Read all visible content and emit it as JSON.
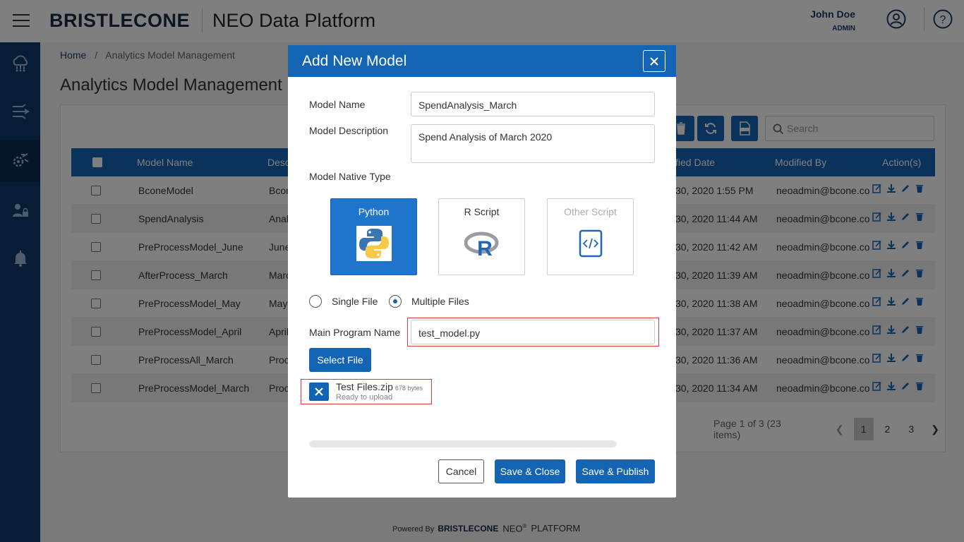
{
  "header": {
    "brand": "BRISTLECONE",
    "app_title": "NEO Data Platform",
    "user_name": "John Doe",
    "user_role": "ADMIN"
  },
  "sidebar": {
    "items": [
      {
        "icon": "cloud-network-icon"
      },
      {
        "icon": "data-flow-icon"
      },
      {
        "icon": "analytics-model-icon",
        "active": true
      },
      {
        "icon": "user-admin-icon"
      },
      {
        "icon": "bell-icon"
      }
    ]
  },
  "breadcrumb": {
    "home": "Home",
    "separator": "/",
    "current": "Analytics Model Management"
  },
  "page_title": "Analytics Model Management",
  "toolbar": {
    "search_placeholder": "Search"
  },
  "table": {
    "headers": {
      "model_name": "Model Name",
      "description": "Desc",
      "modified_date": "fied Date",
      "modified_by": "Modified By",
      "actions": "Action(s)"
    },
    "rows": [
      {
        "name": "BconeModel",
        "desc": "Bcon",
        "date": "30, 2020 1:55 PM",
        "by": "neoadmin@bcone.cor"
      },
      {
        "name": "SpendAnalysis",
        "desc": "Anal",
        "date": "30, 2020 11:44 AM",
        "by": "neoadmin@bcone.cor"
      },
      {
        "name": "PreProcessModel_June",
        "desc": "June",
        "date": "30, 2020 11:42 AM",
        "by": "neoadmin@bcone.cor"
      },
      {
        "name": "AfterProcess_March",
        "desc": "Marc",
        "date": "30, 2020 11:39 AM",
        "by": "neoadmin@bcone.cor"
      },
      {
        "name": "PreProcessModel_May",
        "desc": "May",
        "date": "30, 2020 11:38 AM",
        "by": "neoadmin@bcone.cor"
      },
      {
        "name": "PreProcessModel_April",
        "desc": "April",
        "date": "30, 2020 11:37 AM",
        "by": "neoadmin@bcone.cor"
      },
      {
        "name": "PreProcessAll_March",
        "desc": "Proc",
        "date": "30, 2020 11:36 AM",
        "by": "neoadmin@bcone.cor"
      },
      {
        "name": "PreProcessModel_March",
        "desc": "Proc",
        "date": "30, 2020 11:34 AM",
        "by": "neoadmin@bcone.cor"
      }
    ]
  },
  "pager": {
    "info": "Page 1 of 3 (23 items)",
    "pages": [
      "1",
      "2",
      "3"
    ],
    "current": "1"
  },
  "footer": {
    "powered_by": "Powered By",
    "brand": "BRISTLECONE",
    "neo": "NEO",
    "registered": "®",
    "platform": "PLATFORM"
  },
  "modal": {
    "title": "Add New Model",
    "model_name_label": "Model Name",
    "model_name_value": "SpendAnalysis_March",
    "model_desc_label": "Model Description",
    "model_desc_value": "Spend Analysis of March 2020",
    "native_type_label": "Model Native Type",
    "types": [
      {
        "label": "Python",
        "selected": true
      },
      {
        "label": "R Script",
        "selected": false
      },
      {
        "label": "Other Script",
        "selected": false
      }
    ],
    "radio_single": "Single File",
    "radio_multiple": "Multiple Files",
    "radio_selected": "Multiple Files",
    "main_program_label": "Main Program Name",
    "main_program_value": "test_model.py",
    "select_file_label": "Select File",
    "file": {
      "name": "Test Files.zip",
      "size": "678 bytes",
      "status": "Ready to upload"
    },
    "cancel_label": "Cancel",
    "save_close_label": "Save & Close",
    "save_publish_label": "Save & Publish"
  },
  "colors": {
    "primary": "#1464b4",
    "sidebar": "#0f3a6b",
    "highlight_border": "#e03b3b"
  }
}
